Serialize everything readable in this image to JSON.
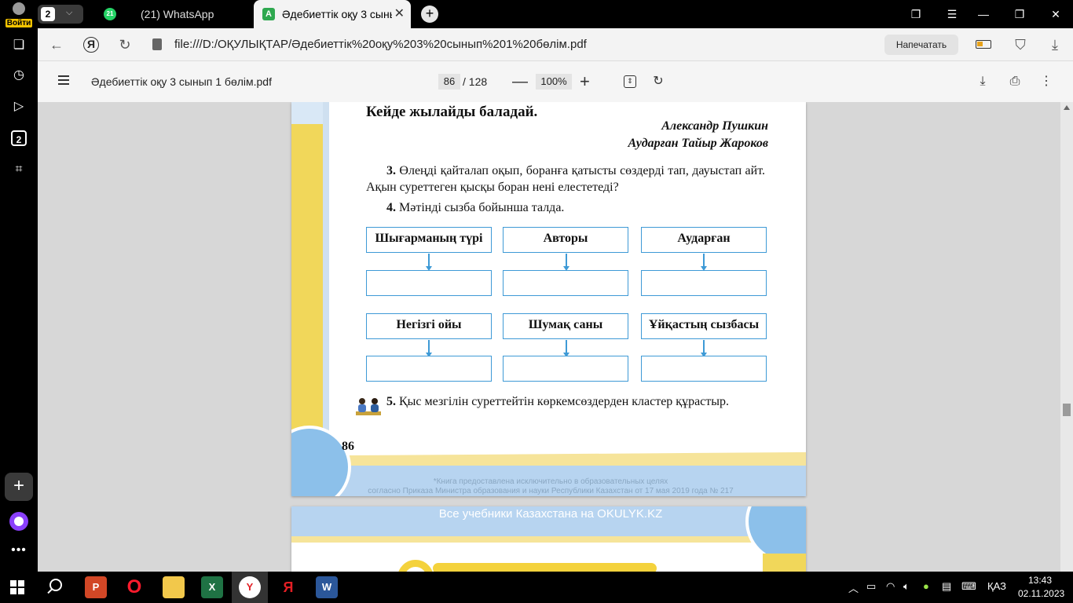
{
  "browser": {
    "login_label": "Войти",
    "tab_count": "2",
    "tabs": [
      {
        "title": "(21) WhatsApp",
        "badge": "21"
      },
      {
        "title": "Әдебиеттік оқу 3 сынып 1 бөлім.pdf"
      }
    ],
    "new_tab_symbol": "+",
    "url": "file:///D:/ОҚУЛЫҚТАР/Әдебиеттік%20оқу%203%20сынып%201%20бөлім.pdf",
    "print_label": "Напечатать",
    "sidebar_badge": "2",
    "colors": {
      "accent_tab_icon": "#2ea84f",
      "whatsapp": "#25d366",
      "alice": "#8a3ffc"
    }
  },
  "pdf_toolbar": {
    "title": "Әдебиеттік оқу 3 сынып 1 бөлім.pdf",
    "page": "86",
    "total": "/ 128",
    "zoom": "100%"
  },
  "page": {
    "poem_last_line": "Кейде жылайды баладай.",
    "author": "Александр Пушкин",
    "translator": "Аударған Тайыр Жароков",
    "task3_num": "3.",
    "task3_text": "Өлеңді қайталап оқып, боранға қатысты сөздерді тап, дауыстап айт. Ақын суреттеген қысқы боран нені елестетеді?",
    "task4_num": "4.",
    "task4_text": "Мәтінді сызба бойынша талда.",
    "boxes": [
      "Шығарманың түрі",
      "Авторы",
      "Аударған",
      "Негізгі ойы",
      "Шумақ саны",
      "Ұйқастың сызбасы"
    ],
    "task5_num": "5.",
    "task5_text": "Қыс мезгілін суреттейтін көркемсөздерден кластер құрастыр.",
    "page_number": "86",
    "notice_line1": "*Книга предоставлена исключительно в образовательных целях",
    "notice_line2": "согласно Приказа Министра образования и науки Республики Казахстан от 17 мая 2019 года № 217",
    "next_page_banner": "Все учебники Казахстана на OKULYK.KZ"
  },
  "taskbar": {
    "apps": [
      "PowerPoint",
      "Opera",
      "Explorer",
      "Excel",
      "Yandex Browser",
      "Yandex",
      "Word"
    ],
    "app_glyphs": {
      "powerpoint": "P",
      "opera": "O",
      "excel": "X",
      "yandex_browser": "Y",
      "yandex": "Я",
      "word": "W"
    },
    "language": "ҚАЗ",
    "time": "13:43",
    "date": "02.11.2023"
  }
}
